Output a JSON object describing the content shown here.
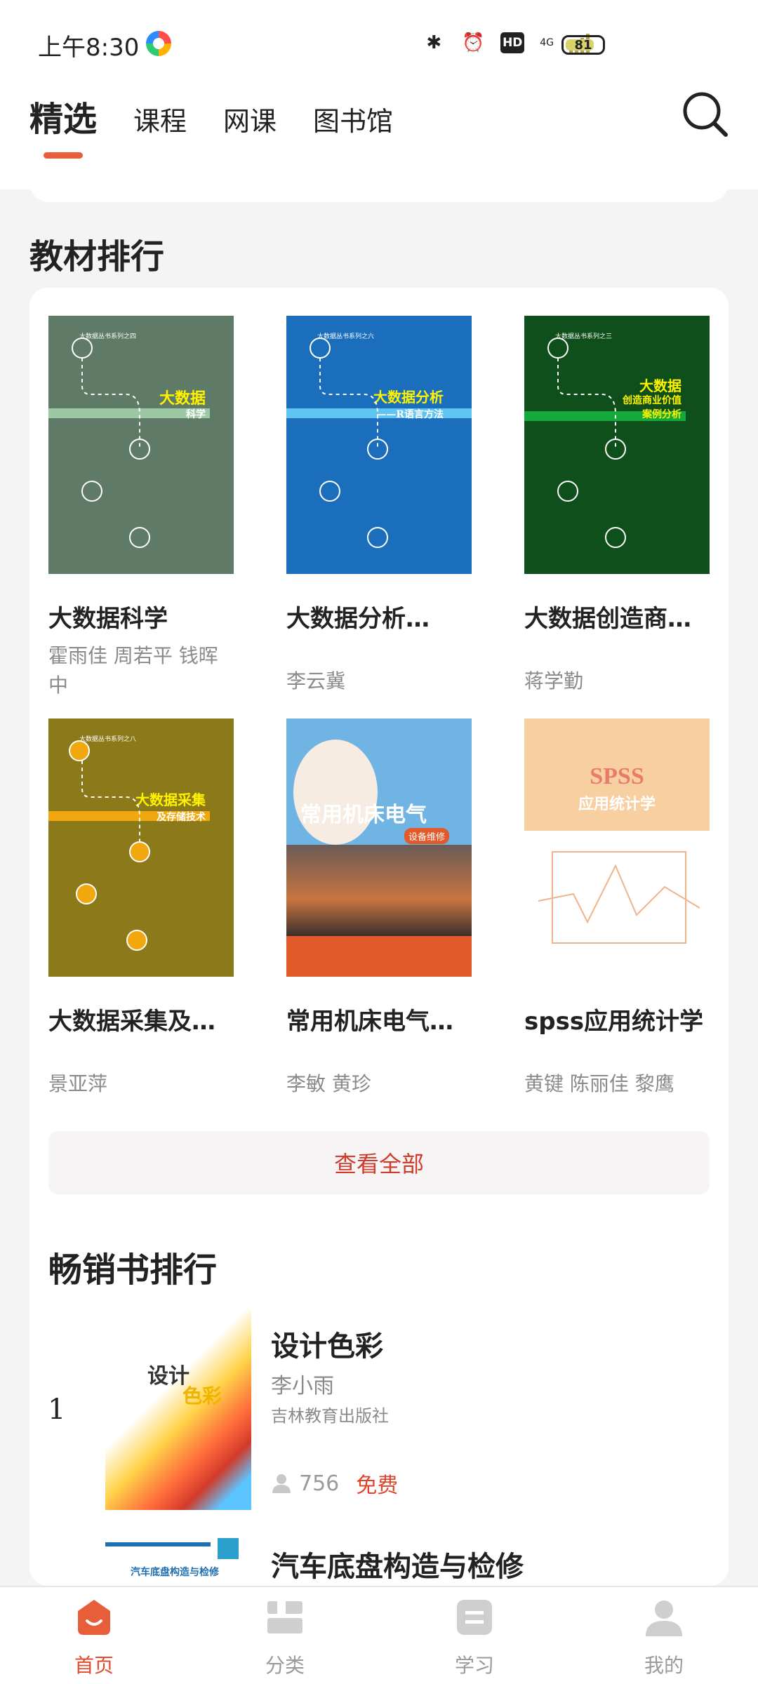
{
  "status": {
    "time": "上午8:30",
    "battery": "81",
    "network": "4G"
  },
  "topnav": {
    "tabs": [
      {
        "label": "精选",
        "active": true
      },
      {
        "label": "课程"
      },
      {
        "label": "网课"
      },
      {
        "label": "图书馆"
      }
    ],
    "search_icon": "search-icon"
  },
  "textbook_section": {
    "title": "教材排行",
    "books": [
      {
        "title": "大数据科学",
        "author": "霍雨佳 周若平 钱晖中",
        "cover_color": "#5f7a66",
        "cover_title": "大数据",
        "cover_sub": "科学",
        "series": "大数据丛书系列之四"
      },
      {
        "title": "大数据分析…",
        "author": "李云冀",
        "cover_color": "#1a6ebc",
        "cover_title": "大数据分析",
        "cover_sub": "——R语言方法",
        "series": "大数据丛书系列之六"
      },
      {
        "title": "大数据创造商…",
        "author": "蒋学勤",
        "cover_color": "#0e4f1c",
        "cover_title": "大数据",
        "cover_sub": "创造商业价值 案例分析",
        "series": "大数据丛书系列之三"
      },
      {
        "title": "大数据采集及…",
        "author": "景亚萍",
        "cover_color": "#8c7a1a",
        "cover_title": "大数据采集",
        "cover_sub": "及存储技术",
        "series": "大数据丛书系列之八"
      },
      {
        "title": "常用机床电气…",
        "author": "李敏 黄珍",
        "cover_color": "#6fb4e3",
        "cover_title": "常用机床电气",
        "cover_sub": "设备维修",
        "series": ""
      },
      {
        "title": "spss应用统计学",
        "author": "黄键 陈丽佳 黎鹰",
        "cover_color": "#f8cfa0",
        "cover_title": "SPSS",
        "cover_sub": "应用统计学",
        "series": ""
      }
    ],
    "view_all": "查看全部"
  },
  "bestseller_section": {
    "title": "畅销书排行",
    "items": [
      {
        "rank": "1",
        "title": "设计色彩",
        "author": "李小雨",
        "publisher": "吉林教育出版社",
        "readers": "756",
        "price": "免费",
        "cover_title": "设计",
        "cover_sub": "色彩"
      },
      {
        "title": "汽车底盘构造与检修",
        "cover_title": "汽车底盘构造与检修"
      }
    ]
  },
  "bottom_nav": [
    {
      "label": "首页",
      "icon": "home-icon",
      "active": true
    },
    {
      "label": "分类",
      "icon": "category-icon"
    },
    {
      "label": "学习",
      "icon": "study-icon"
    },
    {
      "label": "我的",
      "icon": "profile-icon"
    }
  ],
  "colors": {
    "accent": "#e34a2e",
    "link_red": "#d23a2a"
  }
}
